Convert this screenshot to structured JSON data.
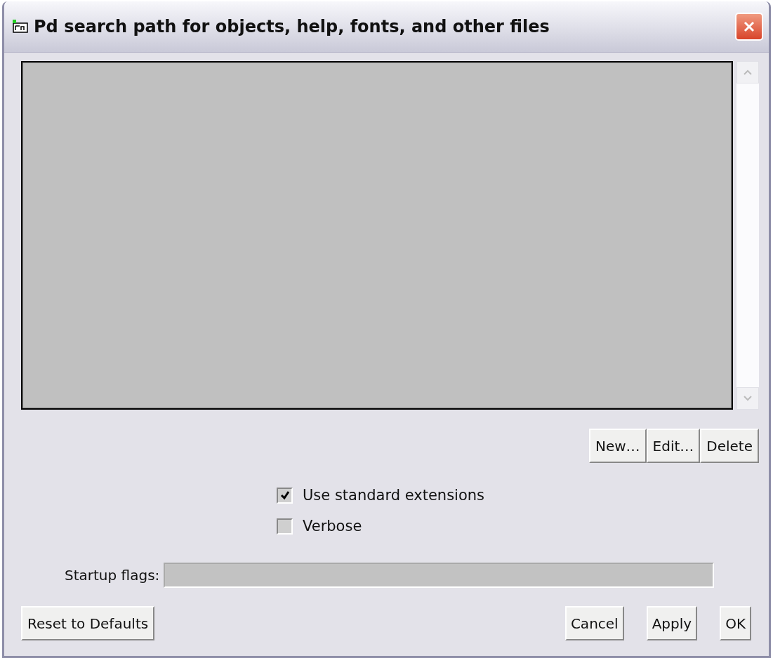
{
  "window": {
    "title": "Pd search path for objects, help, fonts, and other files"
  },
  "path_buttons": [
    "New…",
    "Edit…",
    "Delete"
  ],
  "options": [
    {
      "label": "Use standard extensions",
      "checked": true
    },
    {
      "label": "Verbose",
      "checked": false
    }
  ],
  "startup_flags": {
    "label": "Startup flags:"
  },
  "reset_button": "Reset to Defaults",
  "dialog_buttons": [
    "Cancel",
    "Apply",
    "OK"
  ]
}
